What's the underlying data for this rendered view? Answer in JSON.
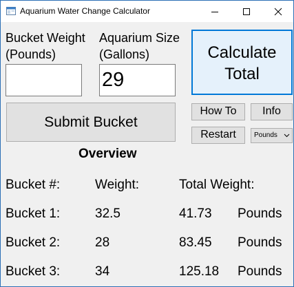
{
  "window": {
    "title": "Aquarium Water Change Calculator",
    "icon": "app-window-icon",
    "controls": [
      "minimize-icon",
      "maximize-icon",
      "close-icon"
    ]
  },
  "inputs": {
    "bucket_weight": {
      "label_line1": "Bucket Weight",
      "label_line2": "(Pounds)",
      "value": ""
    },
    "aquarium_size": {
      "label_line1": "Aquarium Size",
      "label_line2": "(Gallons)",
      "value": "29"
    }
  },
  "buttons": {
    "calculate_line1": "Calculate",
    "calculate_line2": "Total",
    "submit": "Submit Bucket",
    "how_to": "How To",
    "info": "Info",
    "restart": "Restart"
  },
  "units_select": {
    "selected": "Pounds"
  },
  "overview": {
    "title": "Overview",
    "headers": [
      "Bucket #:",
      "Weight:",
      "Total Weight:"
    ],
    "rows": [
      {
        "bucket": "Bucket 1:",
        "weight": "32.5",
        "total": "41.73",
        "unit": "Pounds"
      },
      {
        "bucket": "Bucket 2:",
        "weight": "28",
        "total": "83.45",
        "unit": "Pounds"
      },
      {
        "bucket": "Bucket 3:",
        "weight": "34",
        "total": "125.18",
        "unit": "Pounds"
      }
    ]
  },
  "colors": {
    "accent": "#0078d7",
    "window_border": "#2b6fb5",
    "background": "#f0f0f0",
    "button_face": "#e1e1e1"
  }
}
